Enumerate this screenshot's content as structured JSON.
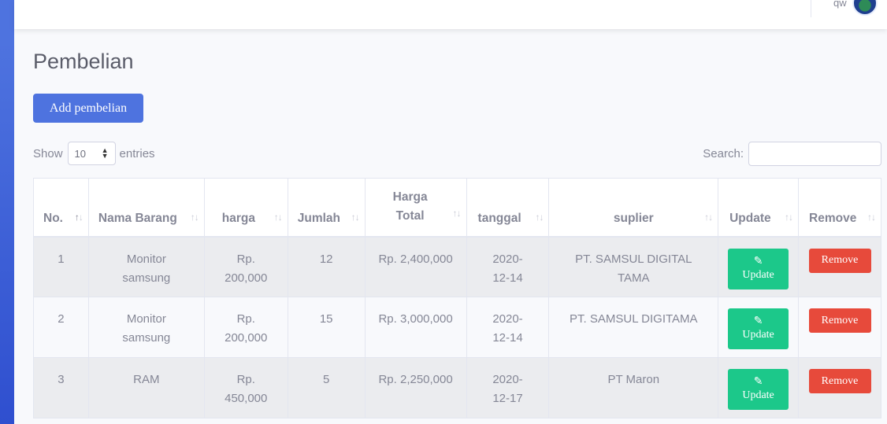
{
  "topbar": {
    "user_name": "qw"
  },
  "page": {
    "title": "Pembelian",
    "add_button": "Add pembelian"
  },
  "length": {
    "show": "Show",
    "value": "10",
    "entries": "entries"
  },
  "search": {
    "label": "Search:"
  },
  "table": {
    "columns": [
      "No.",
      "Nama Barang",
      "harga",
      "Jumlah",
      "Harga Total",
      "tanggal",
      "suplier",
      "Update",
      "Remove"
    ],
    "rows": [
      {
        "no": "1",
        "nama": "Monitor samsung",
        "harga": "Rp. 200,000",
        "jumlah": "12",
        "total": "Rp. 2,400,000",
        "tanggal": "2020-12-14",
        "suplier": "PT. SAMSUL DIGITAL TAMA"
      },
      {
        "no": "2",
        "nama": "Monitor samsung",
        "harga": "Rp. 200,000",
        "jumlah": "15",
        "total": "Rp. 3,000,000",
        "tanggal": "2020-12-14",
        "suplier": "PT. SAMSUL DIGITAMA"
      },
      {
        "no": "3",
        "nama": "RAM",
        "harga": "Rp. 450,000",
        "jumlah": "5",
        "total": "Rp. 2,250,000",
        "tanggal": "2020-12-17",
        "suplier": "PT Maron"
      }
    ],
    "update_label": "Update",
    "remove_label": "Remove"
  },
  "icons": {
    "edit": "edit-icon",
    "sort": "sort-icon",
    "select_arrows": "select-arrows-icon"
  },
  "colors": {
    "primary": "#4e73df",
    "success": "#1cc88a",
    "danger": "#e74a3b"
  }
}
